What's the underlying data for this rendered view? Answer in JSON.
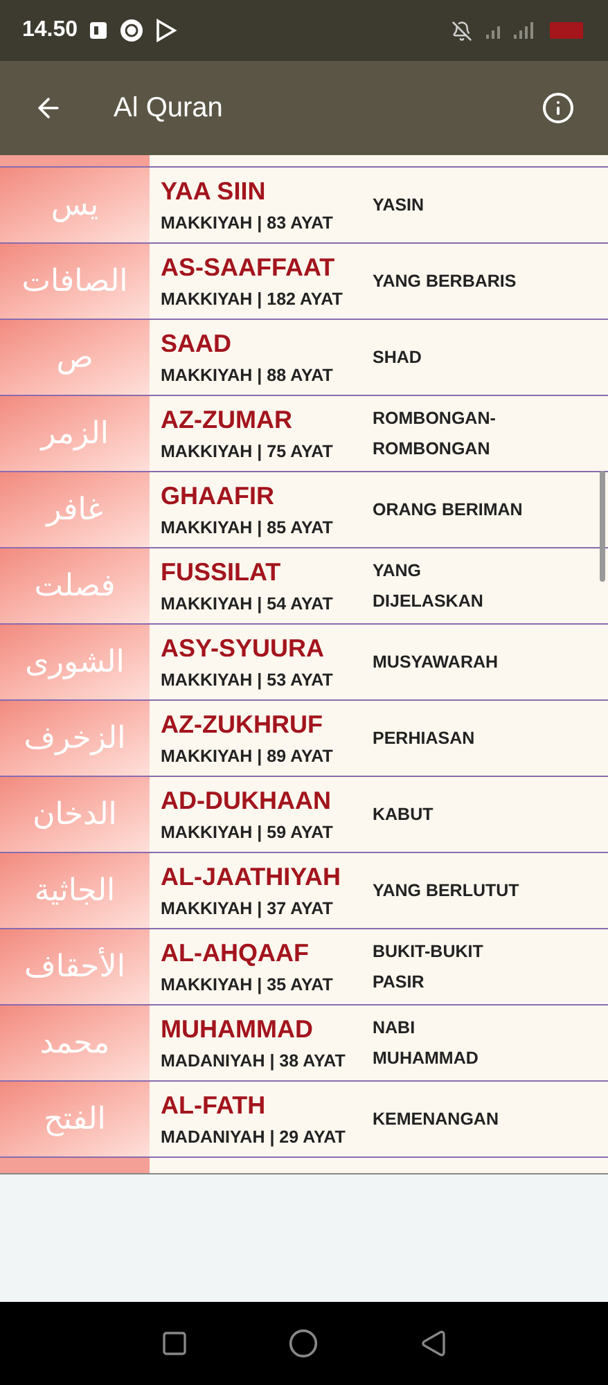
{
  "status_bar": {
    "time": "14.50"
  },
  "app_bar": {
    "title": "Al Quran"
  },
  "surahs": [
    {
      "arabic": "يس",
      "name": "YAA SIIN",
      "info": "MAKKIYAH | 83 AYAT",
      "meaning": "YASIN"
    },
    {
      "arabic": "الصافات",
      "name": "AS-SAAFFAAT",
      "info": "MAKKIYAH | 182 AYAT",
      "meaning": "YANG BERBARIS"
    },
    {
      "arabic": "ص",
      "name": "SAAD",
      "info": "MAKKIYAH | 88 AYAT",
      "meaning": "SHAD"
    },
    {
      "arabic": "الزمر",
      "name": "AZ-ZUMAR",
      "info": "MAKKIYAH | 75 AYAT",
      "meaning": "ROMBONGAN-ROMBONGAN"
    },
    {
      "arabic": "غافر",
      "name": "GHAAFIR",
      "info": "MAKKIYAH | 85 AYAT",
      "meaning": "ORANG BERIMAN"
    },
    {
      "arabic": "فصلت",
      "name": "FUSSILAT",
      "info": "MAKKIYAH | 54 AYAT",
      "meaning": "YANG DIJELASKAN"
    },
    {
      "arabic": "الشورى",
      "name": "ASY-SYUURA",
      "info": "MAKKIYAH | 53 AYAT",
      "meaning": "MUSYAWARAH"
    },
    {
      "arabic": "الزخرف",
      "name": "AZ-ZUKHRUF",
      "info": "MAKKIYAH | 89 AYAT",
      "meaning": "PERHIASAN"
    },
    {
      "arabic": "الدخان",
      "name": "AD-DUKHAAN",
      "info": "MAKKIYAH | 59 AYAT",
      "meaning": "KABUT"
    },
    {
      "arabic": "الجاثية",
      "name": "AL-JAATHIYAH",
      "info": "MAKKIYAH | 37 AYAT",
      "meaning": "YANG BERLUTUT"
    },
    {
      "arabic": "الأحقاف",
      "name": "AL-AHQAAF",
      "info": "MAKKIYAH | 35 AYAT",
      "meaning": "BUKIT-BUKIT PASIR"
    },
    {
      "arabic": "محمد",
      "name": "MUHAMMAD",
      "info": "MADANIYAH | 38 AYAT",
      "meaning": "NABI MUHAMMAD"
    },
    {
      "arabic": "الفتح",
      "name": "AL-FATH",
      "info": "MADANIYAH | 29 AYAT",
      "meaning": "KEMENANGAN"
    }
  ]
}
